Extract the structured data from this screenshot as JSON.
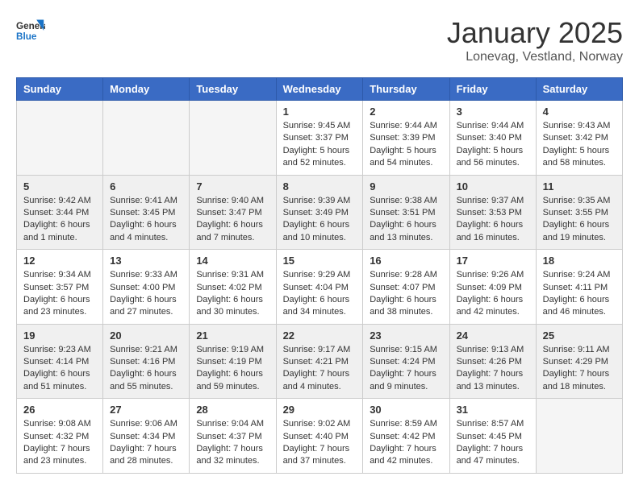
{
  "header": {
    "logo_general": "General",
    "logo_blue": "Blue",
    "month": "January 2025",
    "location": "Lonevag, Vestland, Norway"
  },
  "weekdays": [
    "Sunday",
    "Monday",
    "Tuesday",
    "Wednesday",
    "Thursday",
    "Friday",
    "Saturday"
  ],
  "weeks": [
    [
      {
        "day": "",
        "info": ""
      },
      {
        "day": "",
        "info": ""
      },
      {
        "day": "",
        "info": ""
      },
      {
        "day": "1",
        "info": "Sunrise: 9:45 AM\nSunset: 3:37 PM\nDaylight: 5 hours\nand 52 minutes."
      },
      {
        "day": "2",
        "info": "Sunrise: 9:44 AM\nSunset: 3:39 PM\nDaylight: 5 hours\nand 54 minutes."
      },
      {
        "day": "3",
        "info": "Sunrise: 9:44 AM\nSunset: 3:40 PM\nDaylight: 5 hours\nand 56 minutes."
      },
      {
        "day": "4",
        "info": "Sunrise: 9:43 AM\nSunset: 3:42 PM\nDaylight: 5 hours\nand 58 minutes."
      }
    ],
    [
      {
        "day": "5",
        "info": "Sunrise: 9:42 AM\nSunset: 3:44 PM\nDaylight: 6 hours\nand 1 minute."
      },
      {
        "day": "6",
        "info": "Sunrise: 9:41 AM\nSunset: 3:45 PM\nDaylight: 6 hours\nand 4 minutes."
      },
      {
        "day": "7",
        "info": "Sunrise: 9:40 AM\nSunset: 3:47 PM\nDaylight: 6 hours\nand 7 minutes."
      },
      {
        "day": "8",
        "info": "Sunrise: 9:39 AM\nSunset: 3:49 PM\nDaylight: 6 hours\nand 10 minutes."
      },
      {
        "day": "9",
        "info": "Sunrise: 9:38 AM\nSunset: 3:51 PM\nDaylight: 6 hours\nand 13 minutes."
      },
      {
        "day": "10",
        "info": "Sunrise: 9:37 AM\nSunset: 3:53 PM\nDaylight: 6 hours\nand 16 minutes."
      },
      {
        "day": "11",
        "info": "Sunrise: 9:35 AM\nSunset: 3:55 PM\nDaylight: 6 hours\nand 19 minutes."
      }
    ],
    [
      {
        "day": "12",
        "info": "Sunrise: 9:34 AM\nSunset: 3:57 PM\nDaylight: 6 hours\nand 23 minutes."
      },
      {
        "day": "13",
        "info": "Sunrise: 9:33 AM\nSunset: 4:00 PM\nDaylight: 6 hours\nand 27 minutes."
      },
      {
        "day": "14",
        "info": "Sunrise: 9:31 AM\nSunset: 4:02 PM\nDaylight: 6 hours\nand 30 minutes."
      },
      {
        "day": "15",
        "info": "Sunrise: 9:29 AM\nSunset: 4:04 PM\nDaylight: 6 hours\nand 34 minutes."
      },
      {
        "day": "16",
        "info": "Sunrise: 9:28 AM\nSunset: 4:07 PM\nDaylight: 6 hours\nand 38 minutes."
      },
      {
        "day": "17",
        "info": "Sunrise: 9:26 AM\nSunset: 4:09 PM\nDaylight: 6 hours\nand 42 minutes."
      },
      {
        "day": "18",
        "info": "Sunrise: 9:24 AM\nSunset: 4:11 PM\nDaylight: 6 hours\nand 46 minutes."
      }
    ],
    [
      {
        "day": "19",
        "info": "Sunrise: 9:23 AM\nSunset: 4:14 PM\nDaylight: 6 hours\nand 51 minutes."
      },
      {
        "day": "20",
        "info": "Sunrise: 9:21 AM\nSunset: 4:16 PM\nDaylight: 6 hours\nand 55 minutes."
      },
      {
        "day": "21",
        "info": "Sunrise: 9:19 AM\nSunset: 4:19 PM\nDaylight: 6 hours\nand 59 minutes."
      },
      {
        "day": "22",
        "info": "Sunrise: 9:17 AM\nSunset: 4:21 PM\nDaylight: 7 hours\nand 4 minutes."
      },
      {
        "day": "23",
        "info": "Sunrise: 9:15 AM\nSunset: 4:24 PM\nDaylight: 7 hours\nand 9 minutes."
      },
      {
        "day": "24",
        "info": "Sunrise: 9:13 AM\nSunset: 4:26 PM\nDaylight: 7 hours\nand 13 minutes."
      },
      {
        "day": "25",
        "info": "Sunrise: 9:11 AM\nSunset: 4:29 PM\nDaylight: 7 hours\nand 18 minutes."
      }
    ],
    [
      {
        "day": "26",
        "info": "Sunrise: 9:08 AM\nSunset: 4:32 PM\nDaylight: 7 hours\nand 23 minutes."
      },
      {
        "day": "27",
        "info": "Sunrise: 9:06 AM\nSunset: 4:34 PM\nDaylight: 7 hours\nand 28 minutes."
      },
      {
        "day": "28",
        "info": "Sunrise: 9:04 AM\nSunset: 4:37 PM\nDaylight: 7 hours\nand 32 minutes."
      },
      {
        "day": "29",
        "info": "Sunrise: 9:02 AM\nSunset: 4:40 PM\nDaylight: 7 hours\nand 37 minutes."
      },
      {
        "day": "30",
        "info": "Sunrise: 8:59 AM\nSunset: 4:42 PM\nDaylight: 7 hours\nand 42 minutes."
      },
      {
        "day": "31",
        "info": "Sunrise: 8:57 AM\nSunset: 4:45 PM\nDaylight: 7 hours\nand 47 minutes."
      },
      {
        "day": "",
        "info": ""
      }
    ]
  ]
}
